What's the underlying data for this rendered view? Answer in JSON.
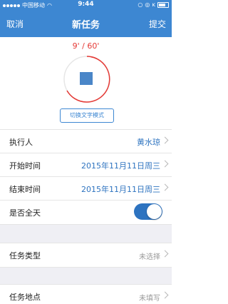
{
  "status_bar": {
    "carrier": "中国移动",
    "time": "9:44"
  },
  "nav": {
    "cancel": "取消",
    "title": "新任务",
    "submit": "提交"
  },
  "recorder": {
    "timer": "9' / 60'",
    "toggle_mode_label": "切换文字模式"
  },
  "form": {
    "executor": {
      "label": "执行人",
      "value": "黄水琼"
    },
    "start_time": {
      "label": "开始时间",
      "value": "2015年11月11日周三"
    },
    "end_time": {
      "label": "结束时间",
      "value": "2015年11月11日周三"
    },
    "all_day": {
      "label": "是否全天",
      "on": true
    },
    "task_type": {
      "label": "任务类型",
      "value": "未选择"
    },
    "task_location": {
      "label": "任务地点",
      "value": "未填写"
    }
  },
  "colors": {
    "accent": "#3d87d2",
    "timer_red": "#e53935",
    "value_blue": "#2f74c0"
  }
}
